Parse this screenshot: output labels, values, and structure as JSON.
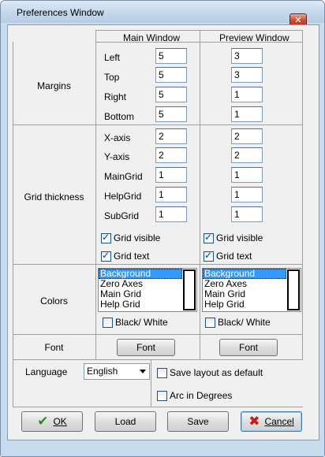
{
  "window": {
    "title": "Preferences Window",
    "close_glyph": "✕"
  },
  "columns": {
    "main": "Main Window",
    "preview": "Preview Window"
  },
  "margins": {
    "label": "Margins",
    "rows": [
      {
        "label": "Left",
        "main": "5",
        "preview": "3"
      },
      {
        "label": "Top",
        "main": "5",
        "preview": "3"
      },
      {
        "label": "Right",
        "main": "5",
        "preview": "1"
      },
      {
        "label": "Bottom",
        "main": "5",
        "preview": "1"
      }
    ]
  },
  "grid": {
    "label": "Grid thickness",
    "rows": [
      {
        "label": "X-axis",
        "main": "2",
        "preview": "2"
      },
      {
        "label": "Y-axis",
        "main": "2",
        "preview": "2"
      },
      {
        "label": "MainGrid",
        "main": "1",
        "preview": "1"
      },
      {
        "label": "HelpGrid",
        "main": "1",
        "preview": "1"
      },
      {
        "label": "SubGrid",
        "main": "1",
        "preview": "1"
      }
    ],
    "visible_label": "Grid visible",
    "text_label": "Grid text",
    "main_visible": true,
    "main_text": true,
    "preview_visible": true,
    "preview_text": true
  },
  "colors": {
    "label": "Colors",
    "items": [
      "Background",
      "Zero Axes",
      "Main Grid",
      "Help Grid"
    ],
    "selected": "Background",
    "bw_label": "Black/ White"
  },
  "font": {
    "label": "Font",
    "button": "Font"
  },
  "language": {
    "label": "Language",
    "value": "English"
  },
  "options": {
    "save_layout": "Save layout as default",
    "arc_degrees": "Arc in  Degrees"
  },
  "buttons": {
    "ok": "OK",
    "load": "Load",
    "save": "Save",
    "cancel": "Cancel"
  },
  "icons": {
    "ok": "check-icon",
    "cancel": "x-icon",
    "close": "close-icon"
  },
  "colors_theme": {
    "title_bar": "#c7dcef",
    "selection": "#3399ff",
    "ok_icon": "#2e8b1f",
    "cancel_icon": "#c8181b"
  }
}
